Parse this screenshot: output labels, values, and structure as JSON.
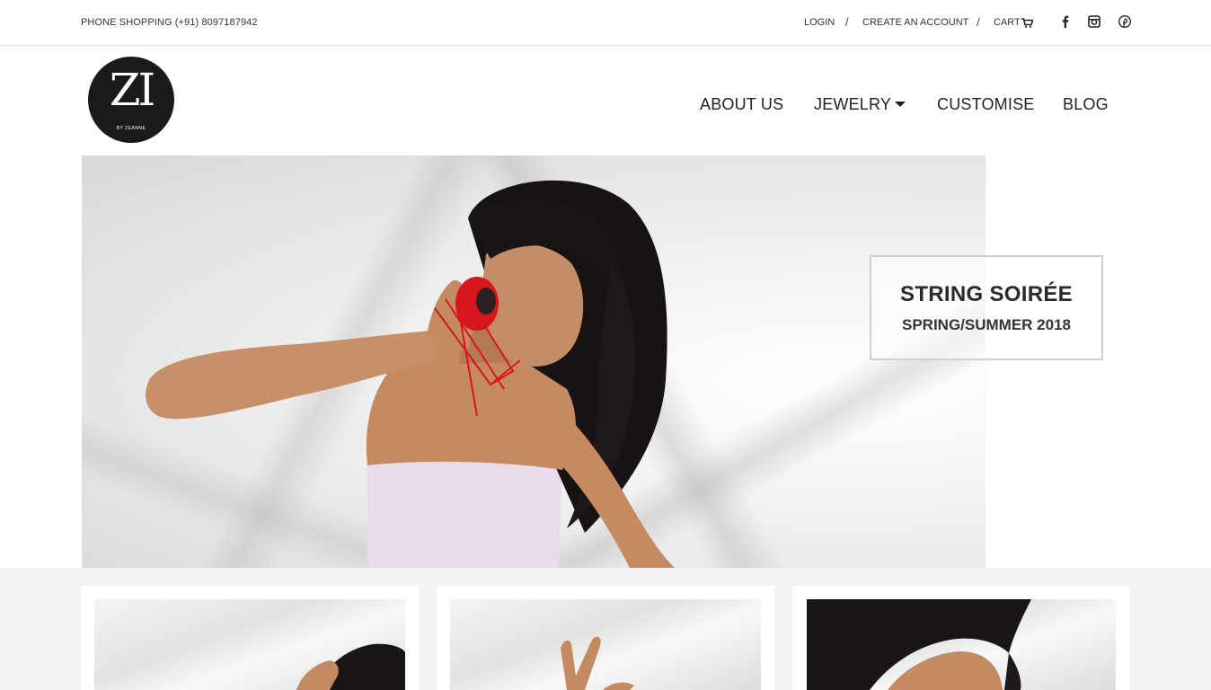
{
  "topbar": {
    "phone": "PHONE SHOPPING (+91) 8097187942",
    "login": "LOGIN",
    "separator": "/",
    "create_account": "CREATE AN ACCOUNT",
    "cart": "CART",
    "social": [
      "facebook-icon",
      "instagram-icon",
      "pinterest-icon"
    ]
  },
  "logo": {
    "mark": "ZI",
    "sub": "BY ZEANNE"
  },
  "nav": {
    "about": "ABOUT US",
    "jewelry": "JEWELRY",
    "customise": "CUSTOMISE",
    "blog": "BLOG"
  },
  "hero": {
    "title": "STRING SOIRÉE",
    "subtitle": "SPRING/SUMMER 2018"
  },
  "colors": {
    "text": "#222222",
    "background": "#ffffff",
    "section_bg": "#f3f3f3",
    "accent_red": "#d8141c"
  }
}
